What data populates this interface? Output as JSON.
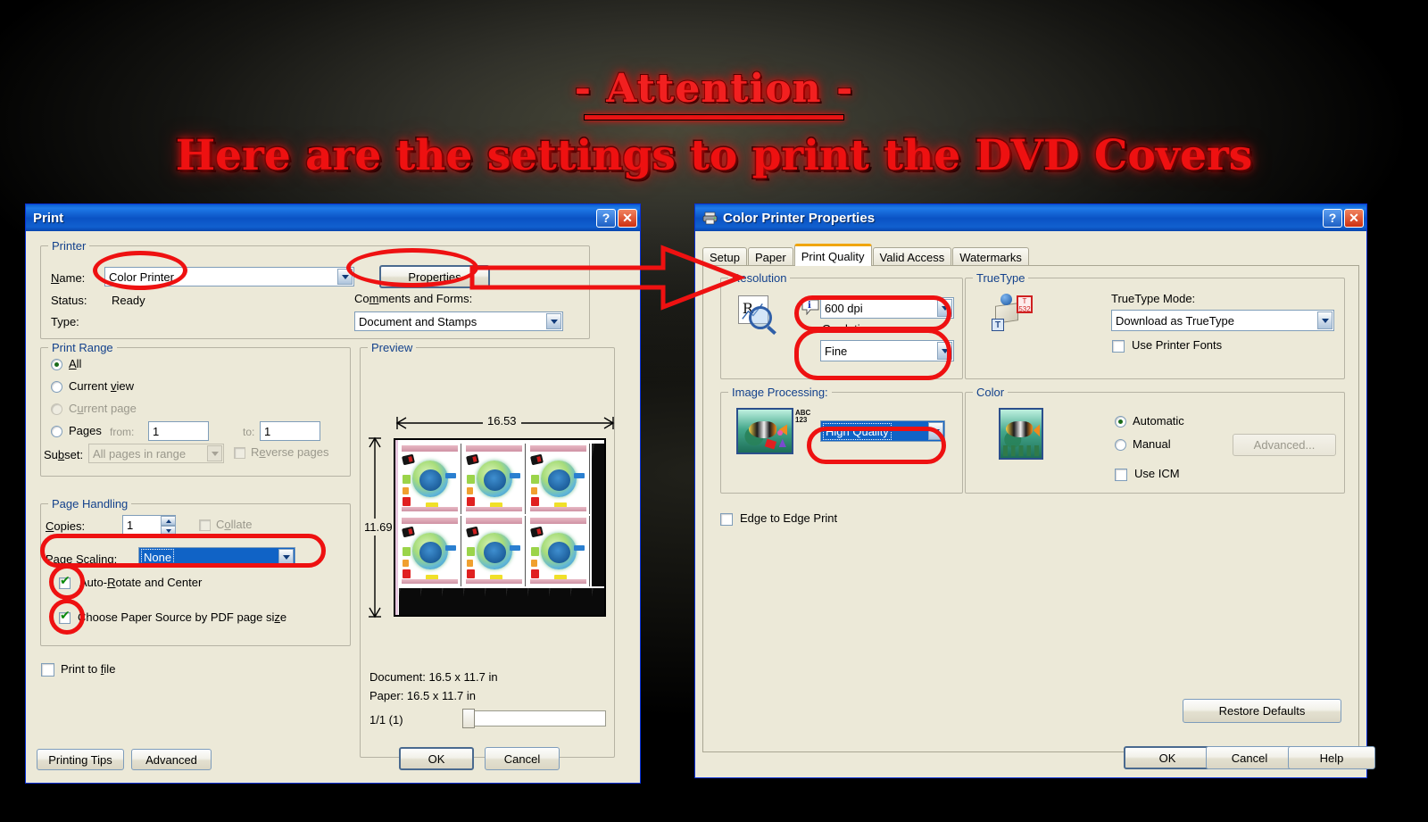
{
  "banner": {
    "line1": "- Attention -",
    "line2": "Here are the settings to print the DVD Covers"
  },
  "print_dialog": {
    "title": "Print",
    "titlebar_buttons": {
      "help": "?",
      "close": "✕"
    },
    "printer_group": {
      "label": "Printer",
      "name_label": "Name:",
      "name_value": "Color Printer",
      "status_label": "Status:",
      "status_value": "Ready",
      "type_label": "Type:",
      "type_value": "",
      "properties_button": "Properties",
      "comments_label": "Comments and Forms:",
      "comments_value": "Document and Stamps"
    },
    "print_range": {
      "label": "Print Range",
      "all": "All",
      "current_view": "Current view",
      "current_page": "Current page",
      "pages": "Pages",
      "from_label": "from:",
      "from_value": "1",
      "to_label": "to:",
      "to_value": "1",
      "subset_label": "Subset:",
      "subset_value": "All pages in range",
      "reverse_pages": "Reverse pages",
      "selected": "All"
    },
    "page_handling": {
      "label": "Page Handling",
      "copies_label": "Copies:",
      "copies_value": "1",
      "collate": "Collate",
      "page_scaling_label": "Page Scaling:",
      "page_scaling_value": "None",
      "auto_rotate": "Auto-Rotate and Center",
      "auto_rotate_checked": true,
      "choose_paper_source": "Choose Paper Source by PDF page size",
      "choose_paper_source_checked": true
    },
    "preview": {
      "label": "Preview",
      "width_dim": "16.53",
      "height_dim": "11.69",
      "document_line": "Document: 16.5 x 11.7 in",
      "paper_line": "Paper: 16.5 x 11.7 in",
      "page_counter": "1/1 (1)"
    },
    "print_to_file": "Print to file",
    "print_to_file_checked": false,
    "buttons": {
      "printing_tips": "Printing Tips",
      "advanced": "Advanced",
      "ok": "OK",
      "cancel": "Cancel"
    }
  },
  "properties_dialog": {
    "title": "Color Printer Properties",
    "titlebar_buttons": {
      "help": "?",
      "close": "✕"
    },
    "tabs": [
      {
        "label": "Setup",
        "active": false
      },
      {
        "label": "Paper",
        "active": false
      },
      {
        "label": "Print Quality",
        "active": true
      },
      {
        "label": "Valid Access",
        "active": false
      },
      {
        "label": "Watermarks",
        "active": false
      }
    ],
    "resolution": {
      "label": "Resolution",
      "dpi_value": "600 dpi",
      "gradation_label": "Gradation",
      "gradation_value": "Fine"
    },
    "truetype": {
      "label": "TrueType",
      "mode_label": "TrueType Mode:",
      "mode_value": "Download as TrueType",
      "use_printer_fonts": "Use Printer Fonts",
      "use_printer_fonts_checked": false
    },
    "image_processing": {
      "label": "Image Processing:",
      "value": "High Quality",
      "icon_text_top": "ABC",
      "icon_text_bottom": "123"
    },
    "color": {
      "label": "Color",
      "automatic": "Automatic",
      "manual": "Manual",
      "selected": "Automatic",
      "advanced_button": "Advanced...",
      "use_icm": "Use ICM",
      "use_icm_checked": false
    },
    "edge_to_edge": "Edge to Edge Print",
    "edge_to_edge_checked": false,
    "buttons": {
      "restore_defaults": "Restore Defaults",
      "ok": "OK",
      "cancel": "Cancel",
      "help": "Help"
    }
  },
  "annotations": {
    "accent_color": "#ee1111",
    "arrow_direction": "left-to-right"
  }
}
